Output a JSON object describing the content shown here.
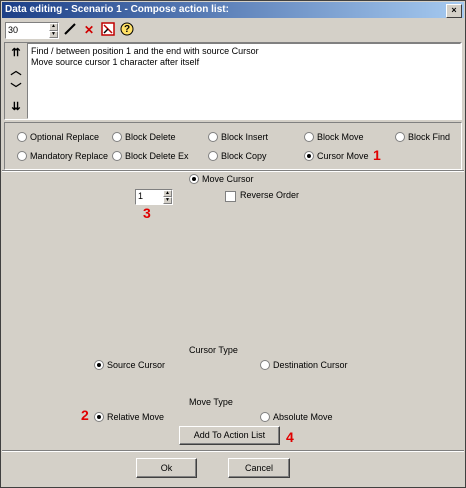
{
  "window": {
    "title": "Data editing - Scenario 1 - Compose action list:",
    "close_glyph": "×"
  },
  "toolbar": {
    "counter_value": "30",
    "edit_icon": "pencil-icon",
    "delete_icon": "delete-icon",
    "tool_icon": "tool-icon",
    "help_icon": "help-icon",
    "help_glyph": "?",
    "delete_glyph": "✕"
  },
  "nav": {
    "top": "⇈",
    "up": "︿",
    "down": "﹀",
    "bottom": "⇊"
  },
  "action_list": [
    "Find / between position 1 and the end with source Cursor",
    "Move source cursor 1 character after itself"
  ],
  "action_types": {
    "row1": [
      "Optional Replace",
      "Block Delete",
      "Block Insert",
      "Block Move",
      "Block Find"
    ],
    "row2": [
      "Mandatory Replace",
      "Block Delete Ex",
      "Block Copy",
      "Cursor Move"
    ],
    "selected": "Cursor Move"
  },
  "annotations": {
    "m1": "1",
    "m2": "2",
    "m3": "3",
    "m4": "4"
  },
  "move_cursor": {
    "radio_label": "Move Cursor",
    "count_value": "1",
    "reverse_label": "Reverse Order"
  },
  "cursor_type": {
    "heading": "Cursor Type",
    "source_label": "Source Cursor",
    "destination_label": "Destination Cursor",
    "selected": "Source Cursor"
  },
  "move_type": {
    "heading": "Move Type",
    "relative_label": "Relative Move",
    "absolute_label": "Absolute Move",
    "selected": "Relative Move"
  },
  "buttons": {
    "add": "Add To Action List",
    "ok": "Ok",
    "cancel": "Cancel"
  }
}
